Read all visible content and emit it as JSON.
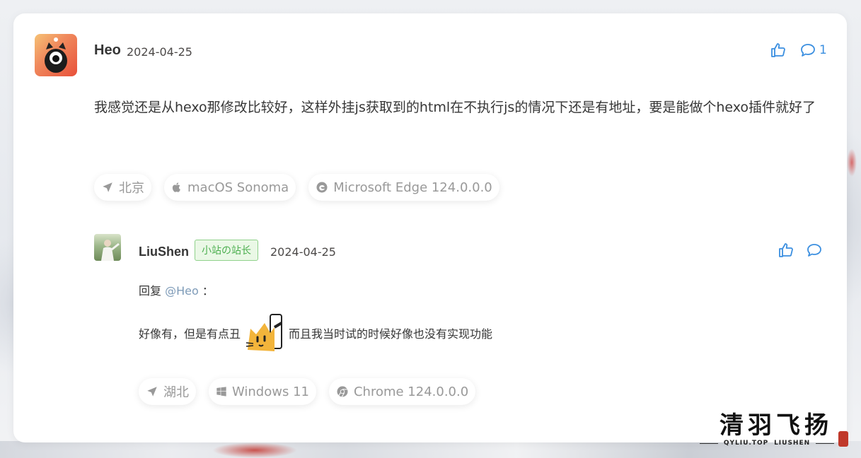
{
  "comment": {
    "author": "Heo",
    "date": "2024-04-25",
    "reply_count": "1",
    "text": "我感觉还是从hexo那修改比较好，这样外挂js获取到的html在不执行js的情况下还是有地址，要是能做个hexo插件就好了",
    "meta": {
      "location": "北京",
      "os": "macOS Sonoma",
      "browser": "Microsoft Edge 124.0.0.0"
    }
  },
  "reply": {
    "author": "LiuShen",
    "badge": "小站の站长",
    "date": "2024-04-25",
    "reply_prefix": "回复",
    "mention": "@Heo",
    "colon": "：",
    "text_before": "好像有，但是有点丑",
    "text_after": "而且我当时试的时候好像也没有实现功能",
    "meta": {
      "location": "湖北",
      "os": "Windows 11",
      "browser": "Chrome 124.0.0.0"
    }
  },
  "watermark": {
    "title": "清羽飞扬",
    "left": "QYLIU.TOP",
    "right": "LIUSHEN"
  },
  "colors": {
    "accent": "#3b8fe0",
    "badge_green": "#4caf50",
    "mention": "#7e9bb8"
  }
}
